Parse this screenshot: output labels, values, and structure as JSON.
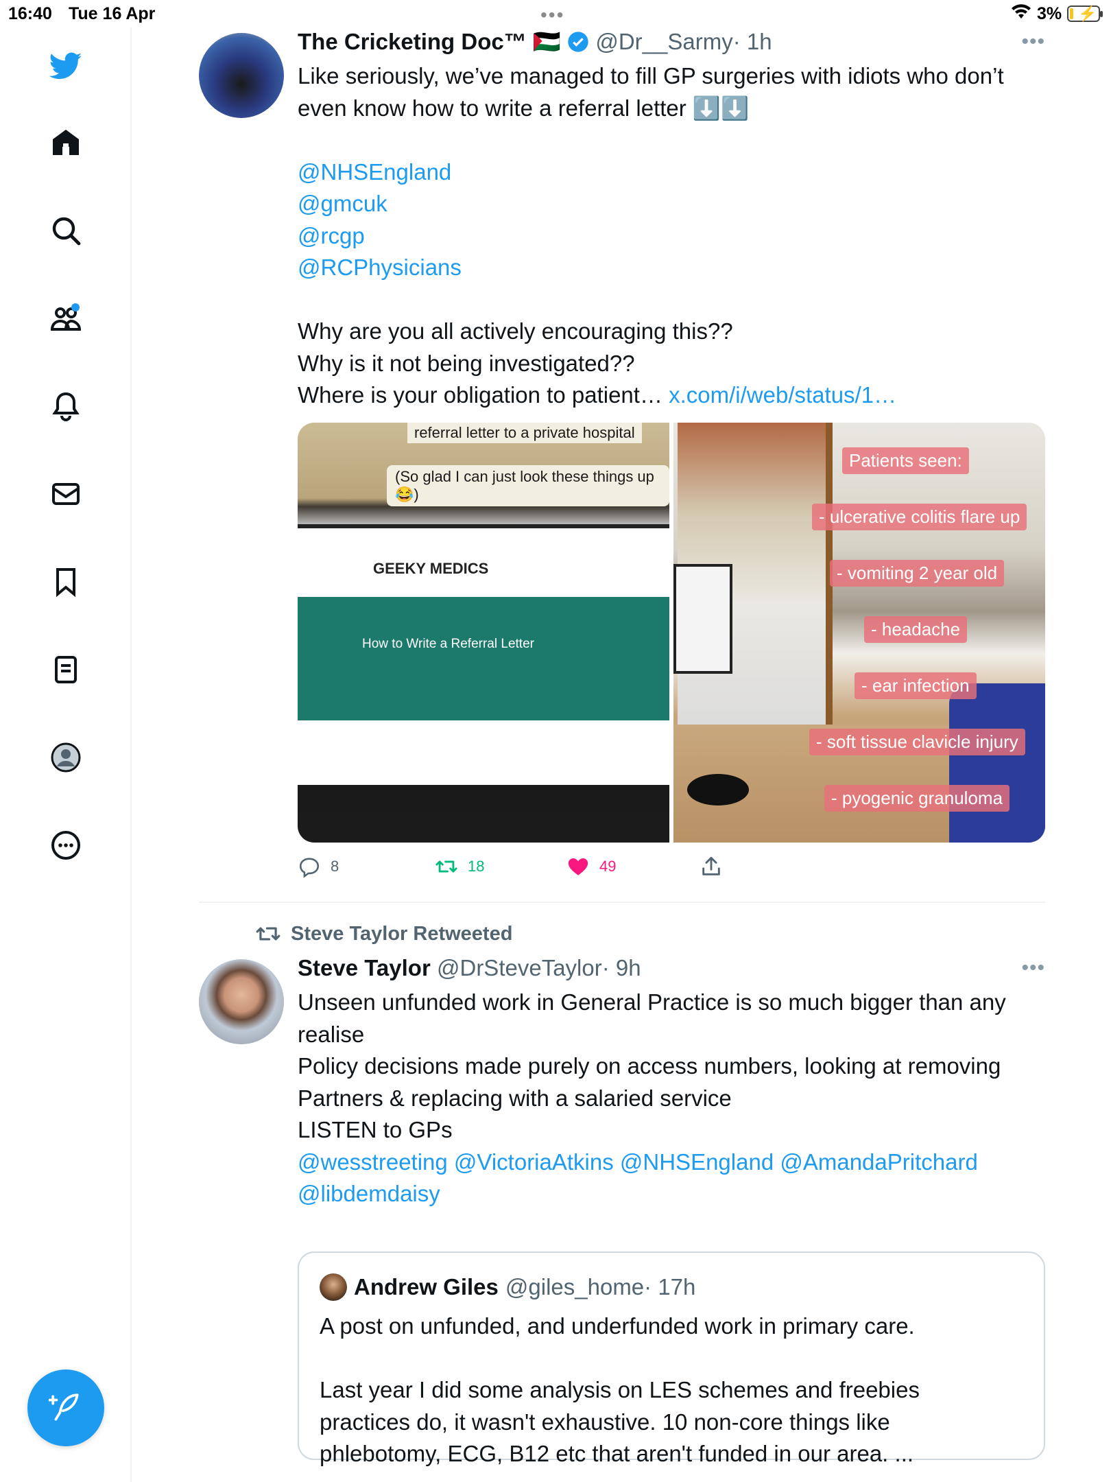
{
  "status_bar": {
    "time": "16:40",
    "date": "Tue 16 Apr",
    "battery": "3%"
  },
  "sidebar": {
    "items": [
      {
        "name": "home-icon"
      },
      {
        "name": "search-icon"
      },
      {
        "name": "communities-icon"
      },
      {
        "name": "notifications-icon"
      },
      {
        "name": "messages-icon"
      },
      {
        "name": "bookmarks-icon"
      },
      {
        "name": "lists-icon"
      },
      {
        "name": "profile-icon"
      },
      {
        "name": "more-icon"
      }
    ],
    "accent": "#1d9bf0"
  },
  "tweet1": {
    "name": "The Cricketing Doc™",
    "flag": "🇵🇸",
    "handle": "@Dr__Sarmy",
    "time": "· 1h",
    "text_lines": [
      "Like seriously, we’ve managed to fill GP surgeries with idiots who don’t",
      "even know how to write a referral letter ⬇️⬇️"
    ],
    "mentions": [
      "@NHSEngland",
      "@gmcuk",
      "@rcgp",
      "@RCPhysicians"
    ],
    "question_lines": [
      "Why are you all actively encouraging this??",
      "Why is it not being investigated??"
    ],
    "last_line": "Where is your obligation to patient…",
    "last_link": "x.com/i/web/status/1…",
    "media": {
      "left_caption_1": "referral letter to a private hospital",
      "left_caption_2": "(So glad I can just look these things up 😂)",
      "left_logo": "GEEKY MEDICS",
      "left_article_title": "How to Write a Referral Letter",
      "right_labels": [
        "Patients seen:",
        "- ulcerative colitis flare up",
        "- vomiting 2 year old",
        "- headache",
        "- ear infection",
        "- soft tissue clavicle injury",
        "- pyogenic granuloma"
      ]
    },
    "replies": "8",
    "retweets": "18",
    "likes": "49"
  },
  "tweet2": {
    "retweeted_by": "Steve Taylor Retweeted",
    "name": "Steve Taylor",
    "handle": "@DrSteveTaylor",
    "time": "· 9h",
    "text_lines": [
      "Unseen unfunded work in General Practice is so much bigger than any",
      "realise",
      "Policy decisions made purely on access numbers, looking at removing",
      "Partners & replacing with a salaried service",
      "LISTEN to GPs"
    ],
    "mentions_line_1": "@wesstreeting @VictoriaAtkins @NHSEngland @AmandaPritchard",
    "mentions_line_2": "@libdemdaisy",
    "quote": {
      "name": "Andrew Giles",
      "handle": "@giles_home",
      "time": "· 17h",
      "lines": [
        "A post on unfunded, and underfunded work in primary care.",
        "",
        "Last year I did some analysis on LES schemes and freebies",
        "practices do, it wasn't exhaustive. 10 non-core things like",
        "phlebotomy, ECG, B12 etc that aren't funded in our area. ..."
      ]
    }
  }
}
